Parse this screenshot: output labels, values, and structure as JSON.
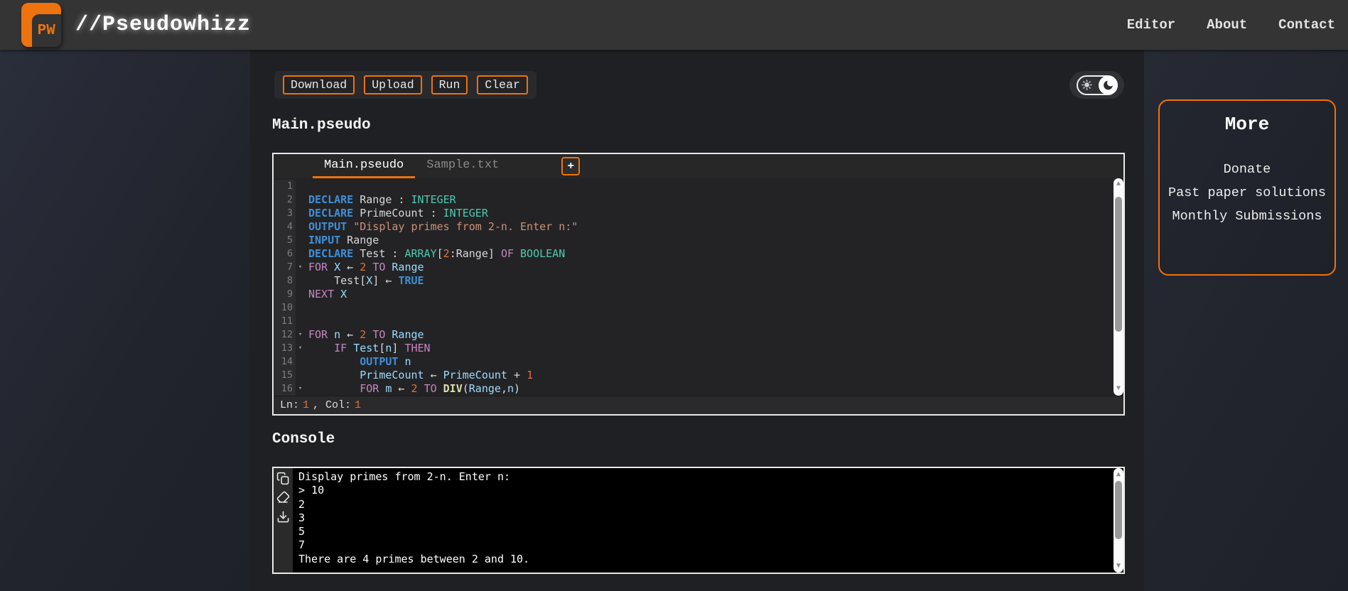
{
  "navbar": {
    "logo_text": "PW",
    "brand": "//Pseudowhizz",
    "links": [
      "Editor",
      "About",
      "Contact"
    ]
  },
  "toolbar": {
    "buttons": [
      "Download",
      "Upload",
      "Run",
      "Clear"
    ]
  },
  "theme_toggle": {
    "state": "dark",
    "icons": [
      "sun-icon",
      "moon-icon"
    ]
  },
  "editor": {
    "heading": "Main.pseudo",
    "tabs": [
      {
        "label": "Main.pseudo",
        "active": true
      },
      {
        "label": "Sample.txt",
        "active": false
      }
    ],
    "new_tab_label": "+",
    "code_lines": [
      {
        "n": 1,
        "fold": false,
        "tokens": []
      },
      {
        "n": 2,
        "fold": false,
        "tokens": [
          [
            "DECLARE",
            "kw"
          ],
          [
            " Range : ",
            "pln"
          ],
          [
            "INTEGER",
            "type"
          ]
        ]
      },
      {
        "n": 3,
        "fold": false,
        "tokens": [
          [
            "DECLARE",
            "kw"
          ],
          [
            " PrimeCount : ",
            "pln"
          ],
          [
            "INTEGER",
            "type"
          ]
        ]
      },
      {
        "n": 4,
        "fold": false,
        "tokens": [
          [
            "OUTPUT",
            "kw"
          ],
          [
            " ",
            "pln"
          ],
          [
            "\"Display primes from 2-n. Enter n:\"",
            "str"
          ]
        ]
      },
      {
        "n": 5,
        "fold": false,
        "tokens": [
          [
            "INPUT",
            "kw"
          ],
          [
            " Range",
            "pln"
          ]
        ]
      },
      {
        "n": 6,
        "fold": false,
        "tokens": [
          [
            "DECLARE",
            "kw"
          ],
          [
            " Test : ",
            "pln"
          ],
          [
            "ARRAY",
            "type"
          ],
          [
            "[",
            "pln"
          ],
          [
            "2",
            "num"
          ],
          [
            ":Range] ",
            "pln"
          ],
          [
            "OF",
            "ctrl"
          ],
          [
            " ",
            "pln"
          ],
          [
            "BOOLEAN",
            "type"
          ]
        ]
      },
      {
        "n": 7,
        "fold": true,
        "tokens": [
          [
            "FOR",
            "ctrl"
          ],
          [
            " ",
            "pln"
          ],
          [
            "X",
            "var"
          ],
          [
            " ← ",
            "pln"
          ],
          [
            "2",
            "num"
          ],
          [
            " ",
            "pln"
          ],
          [
            "TO",
            "ctrl"
          ],
          [
            " ",
            "pln"
          ],
          [
            "Range",
            "var"
          ]
        ]
      },
      {
        "n": 8,
        "fold": false,
        "tokens": [
          [
            "    Test[",
            "pln"
          ],
          [
            "X",
            "var"
          ],
          [
            "] ← ",
            "pln"
          ],
          [
            "TRUE",
            "kw"
          ]
        ]
      },
      {
        "n": 9,
        "fold": false,
        "tokens": [
          [
            "NEXT",
            "ctrl"
          ],
          [
            " ",
            "pln"
          ],
          [
            "X",
            "var"
          ]
        ]
      },
      {
        "n": 10,
        "fold": false,
        "tokens": []
      },
      {
        "n": 11,
        "fold": false,
        "tokens": []
      },
      {
        "n": 12,
        "fold": true,
        "tokens": [
          [
            "FOR",
            "ctrl"
          ],
          [
            " ",
            "pln"
          ],
          [
            "n",
            "var"
          ],
          [
            " ← ",
            "pln"
          ],
          [
            "2",
            "num"
          ],
          [
            " ",
            "pln"
          ],
          [
            "TO",
            "ctrl"
          ],
          [
            " ",
            "pln"
          ],
          [
            "Range",
            "var"
          ]
        ]
      },
      {
        "n": 13,
        "fold": true,
        "tokens": [
          [
            "    ",
            "pln"
          ],
          [
            "IF",
            "ctrl"
          ],
          [
            " ",
            "pln"
          ],
          [
            "Test",
            "var"
          ],
          [
            "[",
            "pln"
          ],
          [
            "n",
            "var"
          ],
          [
            "] ",
            "pln"
          ],
          [
            "THEN",
            "ctrl"
          ]
        ]
      },
      {
        "n": 14,
        "fold": false,
        "tokens": [
          [
            "        ",
            "pln"
          ],
          [
            "OUTPUT",
            "kw"
          ],
          [
            " ",
            "pln"
          ],
          [
            "n",
            "var"
          ]
        ]
      },
      {
        "n": 15,
        "fold": false,
        "tokens": [
          [
            "        ",
            "pln"
          ],
          [
            "PrimeCount",
            "var"
          ],
          [
            " ← ",
            "pln"
          ],
          [
            "PrimeCount",
            "var"
          ],
          [
            " + ",
            "pln"
          ],
          [
            "1",
            "num"
          ]
        ]
      },
      {
        "n": 16,
        "fold": true,
        "tokens": [
          [
            "        ",
            "pln"
          ],
          [
            "FOR",
            "ctrl"
          ],
          [
            " ",
            "pln"
          ],
          [
            "m",
            "var"
          ],
          [
            " ← ",
            "pln"
          ],
          [
            "2",
            "num"
          ],
          [
            " ",
            "pln"
          ],
          [
            "TO",
            "ctrl"
          ],
          [
            " ",
            "pln"
          ],
          [
            "DIV",
            "fn"
          ],
          [
            "(",
            "pln"
          ],
          [
            "Range",
            "var"
          ],
          [
            ",",
            "pln"
          ],
          [
            "n",
            "var"
          ],
          [
            ")",
            "pln"
          ]
        ]
      }
    ],
    "status": {
      "ln_label": "Ln:",
      "ln_value": "1",
      "col_label": ", Col:",
      "col_value": "1"
    }
  },
  "console": {
    "heading": "Console",
    "icons": [
      "copy-icon",
      "eraser-icon",
      "download-icon"
    ],
    "lines": [
      "Display primes from 2-n. Enter n:",
      "> 10",
      "2",
      "3",
      "5",
      "7",
      "There are 4 primes between 2 and 10."
    ]
  },
  "more": {
    "title": "More",
    "links": [
      "Donate",
      "Past paper solutions",
      "Monthly Submissions"
    ]
  },
  "colors": {
    "accent": "#ee720d",
    "keyword_blue": "#3f8fd8",
    "control_magenta": "#c586c0",
    "type_teal": "#4ec9b0",
    "variable_blue": "#9cdcfe",
    "number_orange": "#e0703a",
    "string_tan": "#ce9178",
    "function_yellow": "#dcdcaa",
    "plain_text": "#d8d8d8"
  }
}
